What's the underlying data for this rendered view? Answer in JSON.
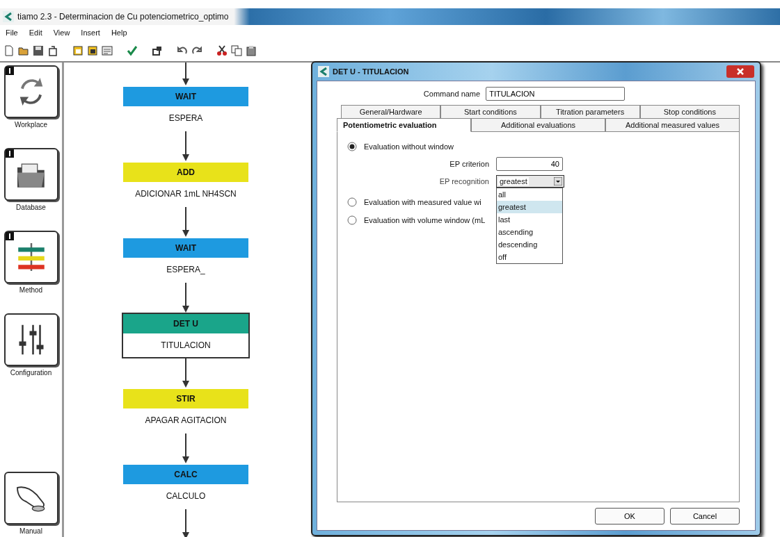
{
  "window": {
    "title": "tiamo 2.3 - Determinacion de Cu potenciometrico_optimo"
  },
  "menu": [
    "File",
    "Edit",
    "View",
    "Insert",
    "Help"
  ],
  "sidebar": {
    "items": [
      {
        "label": "Workplace",
        "kind": "workplace",
        "badge": true
      },
      {
        "label": "Database",
        "kind": "database",
        "badge": true
      },
      {
        "label": "Method",
        "kind": "method",
        "badge": true
      },
      {
        "label": "Configuration",
        "kind": "configuration",
        "badge": false
      },
      {
        "label": "Manual",
        "kind": "manual",
        "badge": false
      }
    ]
  },
  "flow": {
    "nodes": [
      {
        "command": "WAIT",
        "label": "ESPERA",
        "color": "#1e9ae0",
        "selected": false
      },
      {
        "command": "ADD",
        "label": "ADICIONAR 1mL NH4SCN",
        "color": "#e8e21a",
        "selected": false
      },
      {
        "command": "WAIT",
        "label": "ESPERA_",
        "color": "#1e9ae0",
        "selected": false
      },
      {
        "command": "DET U",
        "label": "TITULACION",
        "color": "#1aa58a",
        "selected": true
      },
      {
        "command": "STIR",
        "label": "APAGAR AGITACION",
        "color": "#e8e21a",
        "selected": false
      },
      {
        "command": "CALC",
        "label": "CALCULO",
        "color": "#1e9ae0",
        "selected": false
      }
    ]
  },
  "dialog": {
    "title": "DET U - TITULACION",
    "command_name": {
      "label": "Command name",
      "value": "TITULACION"
    },
    "tabs_row_1": [
      {
        "label": "General/Hardware",
        "selected": false
      },
      {
        "label": "Start conditions",
        "selected": false
      },
      {
        "label": "Titration parameters",
        "selected": false
      },
      {
        "label": "Stop conditions",
        "selected": false
      }
    ],
    "tabs_row_2": [
      {
        "label": "Potentiometric evaluation",
        "selected": true
      },
      {
        "label": "Additional evaluations",
        "selected": false
      },
      {
        "label": "Additional measured values",
        "selected": false
      }
    ],
    "options": [
      {
        "label": "Evaluation without window",
        "selected": true
      },
      {
        "label": "Evaluation with measured value wi",
        "selected": false
      },
      {
        "label": "Evaluation with volume window (mL",
        "selected": false
      }
    ],
    "ep_criterion": {
      "label": "EP criterion",
      "value": "40"
    },
    "ep_recognition": {
      "label": "EP recognition",
      "value": "greatest",
      "expanded": true,
      "options": [
        {
          "label": "all",
          "selected": false
        },
        {
          "label": "greatest",
          "selected": true
        },
        {
          "label": "last",
          "selected": false
        },
        {
          "label": "ascending",
          "selected": false
        },
        {
          "label": "descending",
          "selected": false
        },
        {
          "label": "off",
          "selected": false
        }
      ]
    },
    "buttons": [
      "OK",
      "Cancel"
    ]
  }
}
